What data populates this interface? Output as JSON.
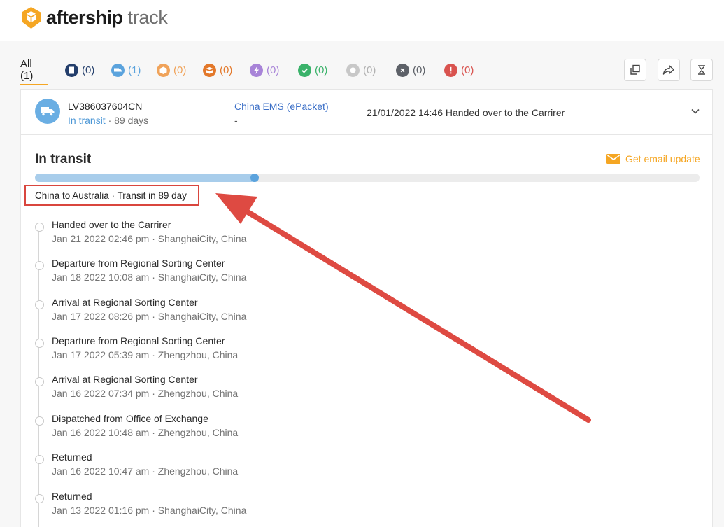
{
  "brand": {
    "name": "aftership",
    "sub": "track",
    "color": "#f5a623"
  },
  "tabs": {
    "all": "All (1)",
    "items": [
      {
        "icon": "document-icon",
        "count": "(0)",
        "color": "#233e6b",
        "text_color": "#233e6b"
      },
      {
        "icon": "truck-icon",
        "count": "(1)",
        "color": "#5ba3dd",
        "text_color": "#5ba3dd"
      },
      {
        "icon": "box-icon",
        "count": "(0)",
        "color": "#f0a35a",
        "text_color": "#f0a35a"
      },
      {
        "icon": "delivery-icon",
        "count": "(0)",
        "color": "#e3782a",
        "text_color": "#e3782a"
      },
      {
        "icon": "bolt-icon",
        "count": "(0)",
        "color": "#a884d8",
        "text_color": "#a884d8"
      },
      {
        "icon": "check-icon",
        "count": "(0)",
        "color": "#3ab26a",
        "text_color": "#3ab26a"
      },
      {
        "icon": "circle-icon",
        "count": "(0)",
        "color": "#c8c8c8",
        "text_color": "#b0b0b0"
      },
      {
        "icon": "x-icon",
        "count": "(0)",
        "color": "#5d6168",
        "text_color": "#5d6168"
      },
      {
        "icon": "alert-icon",
        "count": "(0)",
        "color": "#d9534f",
        "text_color": "#d9534f"
      }
    ]
  },
  "shipment": {
    "tracking_number": "LV386037604CN",
    "status": "In transit",
    "days": " · 89 days",
    "carrier": "China EMS (ePacket)",
    "carrier_sub": "-",
    "latest": "21/01/2022 14:46 Handed over to the Carrirer"
  },
  "detail": {
    "title": "In transit",
    "email_update": "Get email update",
    "progress": 0.33,
    "route": "China to Australia · Transit in 89 day"
  },
  "events": [
    {
      "title": "Handed over to the Carrirer",
      "detail": "Jan 21 2022 02:46 pm · ShanghaiCity, China"
    },
    {
      "title": "Departure from Regional Sorting Center",
      "detail": "Jan 18 2022 10:08 am · ShanghaiCity, China"
    },
    {
      "title": "Arrival at Regional Sorting Center",
      "detail": "Jan 17 2022 08:26 pm · ShanghaiCity, China"
    },
    {
      "title": "Departure from Regional Sorting Center",
      "detail": "Jan 17 2022 05:39 am · Zhengzhou, China"
    },
    {
      "title": "Arrival at Regional Sorting Center",
      "detail": "Jan 16 2022 07:34 pm · Zhengzhou, China"
    },
    {
      "title": "Dispatched from Office of Exchange",
      "detail": "Jan 16 2022 10:48 am · Zhengzhou, China"
    },
    {
      "title": "Returned",
      "detail": "Jan 16 2022 10:47 am · Zhengzhou, China"
    },
    {
      "title": "Returned",
      "detail": "Jan 13 2022 01:16 pm · ShanghaiCity, China"
    }
  ],
  "annotation_color": "#de4a42"
}
